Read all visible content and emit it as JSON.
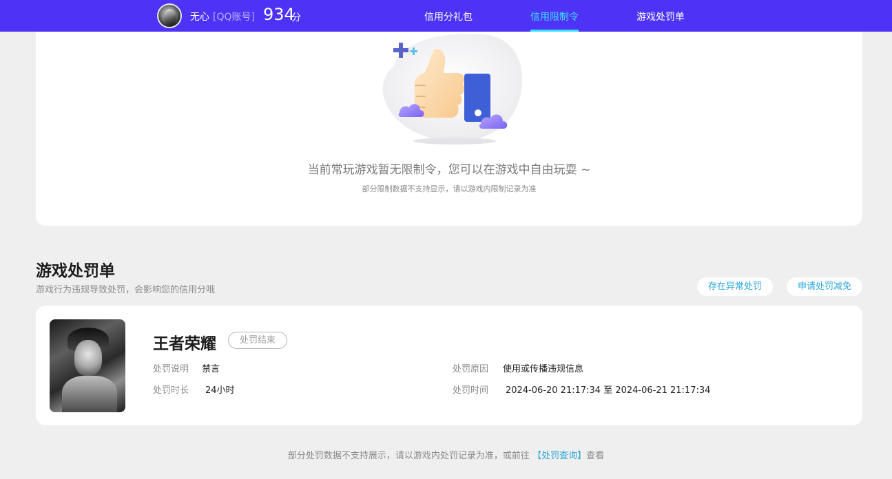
{
  "header": {
    "nickname": "无心",
    "account_type": "[QQ账号]",
    "score": "934",
    "score_unit": "分",
    "nav": [
      {
        "label": "信用分礼包",
        "active": false
      },
      {
        "label": "信用限制令",
        "active": true
      },
      {
        "label": "游戏处罚单",
        "active": false
      }
    ]
  },
  "restriction": {
    "empty_title": "当前常玩游戏暂无限制令，您可以在游戏中自由玩耍 ~",
    "empty_note": "部分限制数据不支持显示，请以游戏内限制记录为准"
  },
  "punishment": {
    "title": "游戏处罚单",
    "subtitle": "游戏行为违规导致处罚，会影响您的信用分哦",
    "actions": {
      "abnormal": "存在异常处罚",
      "apply_reduce": "申请处罚减免"
    },
    "record": {
      "game": "王者荣耀",
      "status": "处罚结束",
      "desc_label": "处罚说明",
      "desc_value": "禁言",
      "duration_label": "处罚时长",
      "duration_value": "24小时",
      "reason_label": "处罚原因",
      "reason_value": "使用或传播违规信息",
      "time_label": "处罚时间",
      "time_value": "2024-06-20 21:17:34 至 2024-06-21 21:17:34"
    },
    "footer_before": "部分处罚数据不支持展示，请以游戏内处罚记录为准，或前往",
    "footer_link": "【处罚查询】",
    "footer_after": "查看"
  },
  "colors": {
    "brand": "#4e33f6",
    "active_nav": "#39e3ff",
    "link": "#2aa7d8",
    "card_bg": "#ffffff",
    "page_bg": "#efefef"
  }
}
